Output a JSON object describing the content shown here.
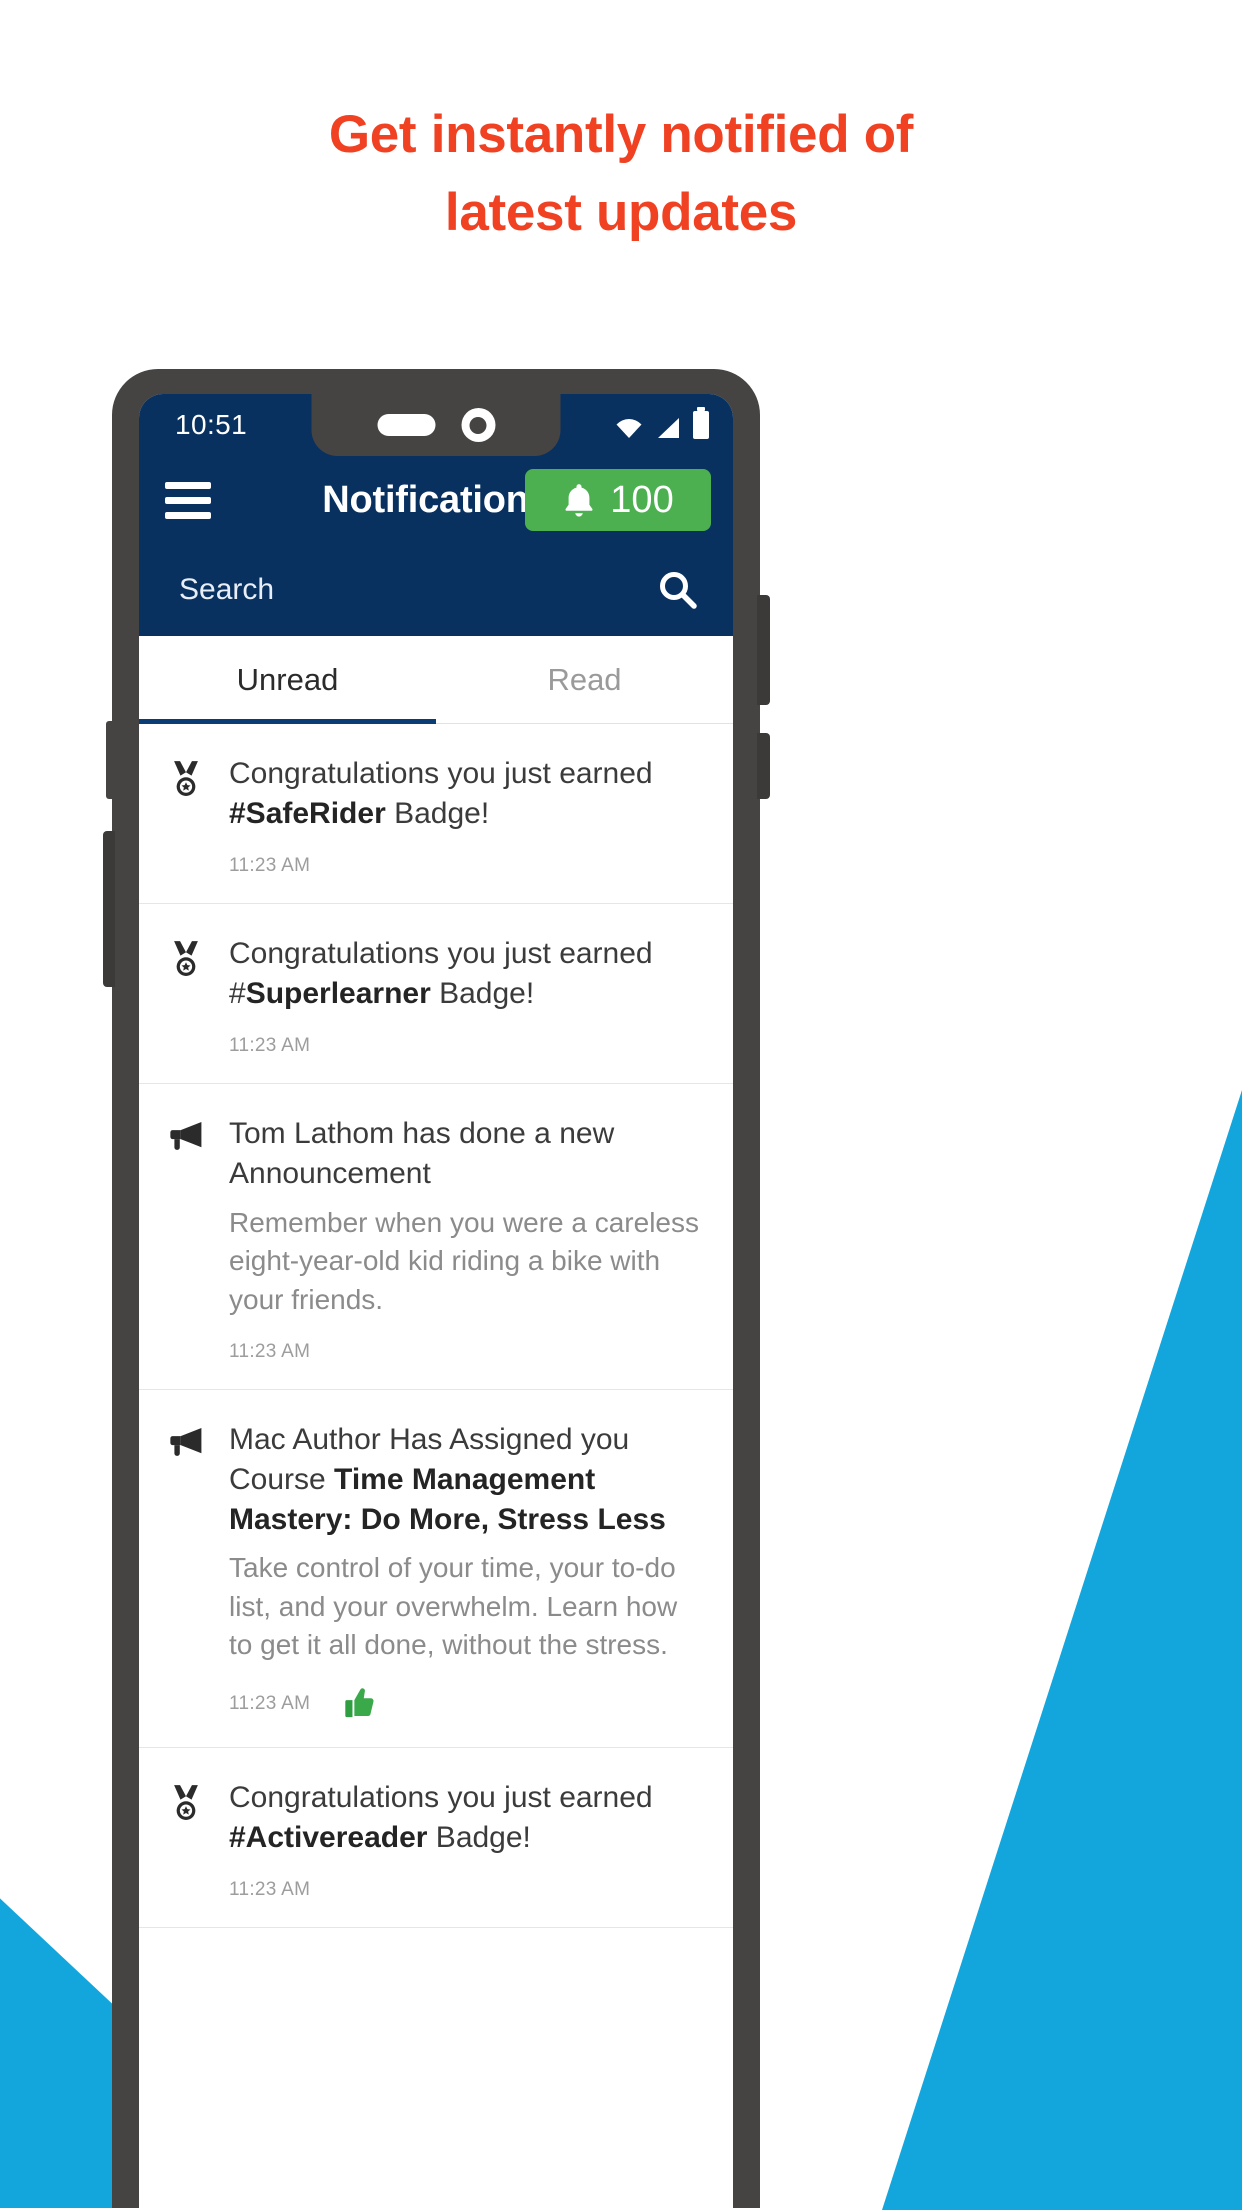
{
  "headline": {
    "line1": "Get instantly notified of",
    "line2": "latest updates",
    "color": "#f04123"
  },
  "colors": {
    "brand_blue": "#083160",
    "accent_cyan": "#13a6dd",
    "badge_green": "#4caf50",
    "tab_underline": "#0b3d74",
    "phone_frame": "#464442"
  },
  "phone": {
    "status_bar": {
      "time": "10:51",
      "icons": [
        "wifi-icon",
        "signal-icon",
        "battery-icon"
      ]
    },
    "app_bar": {
      "menu_icon": "hamburger-menu-icon",
      "title": "Notifications",
      "badge": {
        "icon": "bell-icon",
        "count": "100"
      }
    },
    "search": {
      "placeholder": "Search",
      "value": "",
      "icon": "search-icon"
    },
    "tabs": [
      {
        "label": "Unread",
        "active": true
      },
      {
        "label": "Read",
        "active": false
      }
    ],
    "notifications": [
      {
        "icon": "medal-icon",
        "title_pre": "Congratulations you just earned ",
        "title_bold": "#SafeRider",
        "title_post": " Badge!",
        "description": "",
        "time": "11:23 AM",
        "reaction": ""
      },
      {
        "icon": "medal-icon",
        "title_pre": "Congratulations you just earned #",
        "title_bold": "Superlearner",
        "title_post": " Badge!",
        "description": "",
        "time": "11:23 AM",
        "reaction": ""
      },
      {
        "icon": "megaphone-icon",
        "title_pre": "Tom Lathom has done a new Announcement",
        "title_bold": "",
        "title_post": "",
        "description": "Remember when you were a careless eight-year-old kid riding a bike with your friends.",
        "time": "11:23 AM",
        "reaction": ""
      },
      {
        "icon": "megaphone-icon",
        "title_pre": "Mac Author Has Assigned you Course ",
        "title_bold": "Time Management Mastery: Do More, Stress Less",
        "title_post": "",
        "description": "Take control of your time, your to-do list, and your overwhelm. Learn how to get it all done, without the stress.",
        "time": "11:23 AM",
        "reaction": "thumbs-up-icon"
      },
      {
        "icon": "medal-icon",
        "title_pre": "Congratulations you just earned ",
        "title_bold": "#Activereader",
        "title_post": " Badge!",
        "description": "",
        "time": "11:23 AM",
        "reaction": ""
      }
    ]
  }
}
